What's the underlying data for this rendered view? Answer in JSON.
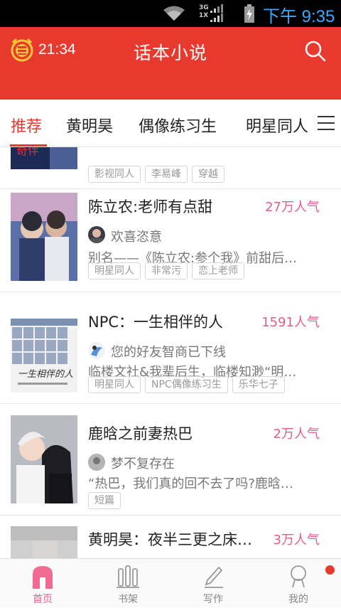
{
  "status_bar": {
    "network_top": "3G",
    "network_bottom": "1X",
    "time": "下午 9:35"
  },
  "header": {
    "timer_icon": "alarm-clock-coin-icon",
    "timer": "21:34",
    "title": "话本小说",
    "search_icon": "search-icon"
  },
  "tabs": {
    "items": [
      "推荐",
      "黄明昊",
      "偶像练习生",
      "明星同人"
    ],
    "active_index": 0,
    "menu_icon": "menu-icon"
  },
  "feed": {
    "items": [
      {
        "tags": [
          "影视同人",
          "李易峰",
          "穿越"
        ]
      },
      {
        "title": "陈立农:老师有点甜",
        "popularity": "27万人气",
        "author": "欢喜恣意",
        "description": "别名——《陈立农:参个我》前甜后…",
        "tags": [
          "明星同人",
          "非常污",
          "恋上老师"
        ]
      },
      {
        "title": "NPC：一生相伴的人",
        "popularity": "1591人气",
        "author": "您的好友智商已下线",
        "description": "临楼文社&我辈后生，临楼知渺“明…",
        "tags": [
          "明星同人",
          "NPC偶像练习生",
          "乐华七子"
        ],
        "cover_text": "一生相伴的人"
      },
      {
        "title": "鹿晗之前妻热巴",
        "popularity": "2万人气",
        "author": "梦不复存在",
        "description": "“热巴，我们真的回不去了吗?鹿晗…",
        "tags": [
          "短篇"
        ]
      },
      {
        "title": "黄明昊：夜半三更之床…",
        "popularity": "3万人气"
      }
    ]
  },
  "bottom_nav": {
    "items": [
      {
        "label": "首页",
        "icon": "home-icon"
      },
      {
        "label": "书架",
        "icon": "bookshelf-icon"
      },
      {
        "label": "写作",
        "icon": "pen-icon"
      },
      {
        "label": "我的",
        "icon": "profile-icon"
      }
    ],
    "active_index": 0
  },
  "colors": {
    "brand_red": "#e8392f",
    "popularity_pink": "#e85a8c",
    "status_blue": "#3aa9ff"
  }
}
